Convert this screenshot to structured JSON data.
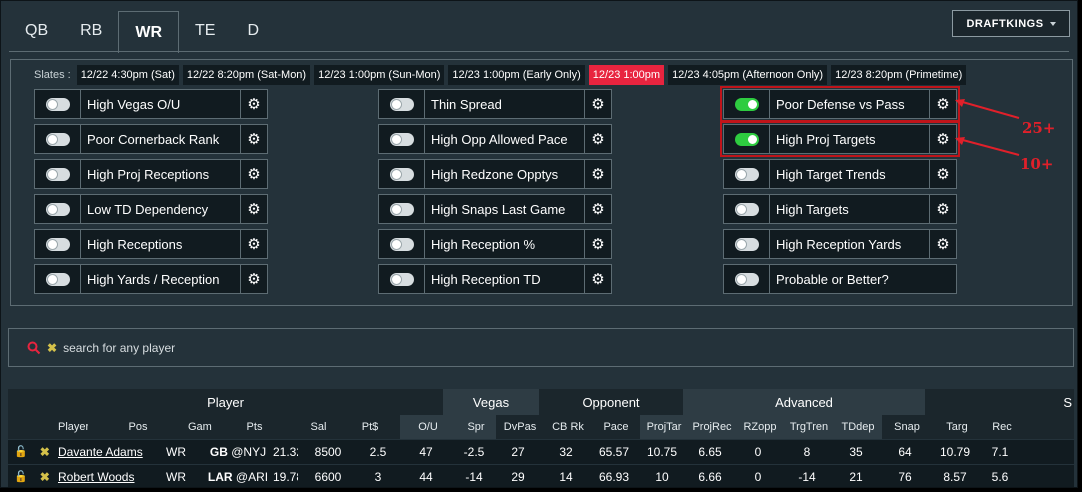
{
  "tabs": [
    "QB",
    "RB",
    "WR",
    "TE",
    "D"
  ],
  "active_tab": "WR",
  "site": "DRAFTKINGS",
  "slates_label": "Slates :",
  "slates": [
    "12/22 4:30pm (Sat)",
    "12/22 8:20pm (Sat-Mon)",
    "12/23 1:00pm (Sun-Mon)",
    "12/23 1:00pm (Early Only)",
    "12/23 1:00pm",
    "12/23 4:05pm (Afternoon Only)",
    "12/23 8:20pm (Primetime)"
  ],
  "active_slate": "12/23 1:00pm",
  "filters": {
    "col1": [
      "High Vegas O/U",
      "Poor Cornerback Rank",
      "High Proj Receptions",
      "Low TD Dependency",
      "High Receptions",
      "High Yards / Reception"
    ],
    "col2": [
      "Thin Spread",
      "High Opp Allowed Pace",
      "High Redzone Opptys",
      "High Snaps Last Game",
      "High Reception %",
      "High Reception TD"
    ],
    "col3": [
      "Poor Defense vs Pass",
      "High Proj Targets",
      "High Target Trends",
      "High Targets",
      "High Reception Yards",
      "Probable or Better?"
    ]
  },
  "annotations": [
    "25+",
    "10+"
  ],
  "colors": {
    "accent": "#e8243f",
    "toggle_on": "#2ecc40",
    "bg": "#24323a"
  },
  "search": {
    "placeholder": "search for any player"
  },
  "table": {
    "groups": [
      "Player",
      "Vegas",
      "Opponent",
      "Advanced"
    ],
    "group_last": "S",
    "headers": [
      "Player",
      "Pos",
      "Game",
      "Pts",
      "Sal",
      "Pt$",
      "O/U",
      "Spr",
      "DvPas",
      "CB Rk",
      "Pace",
      "ProjTar",
      "ProjRec",
      "RZopp",
      "TrgTren",
      "TDdep",
      "Snap",
      "Targ",
      "Rec"
    ],
    "rows": [
      {
        "player": "Davante Adams",
        "pos": "WR",
        "team": "GB",
        "opp": "@NYJ",
        "pts": "21.32",
        "sal": "8500",
        "ptd": "2.5",
        "ou": "47",
        "spr": "-2.5",
        "dvpas": "27",
        "cbrk": "32",
        "pace": "65.57",
        "projtar": "10.75",
        "projrec": "6.65",
        "rzopp": "0",
        "trgtren": "8",
        "tddep": "35",
        "snap": "64",
        "targ": "10.79",
        "rec": "7.1"
      },
      {
        "player": "Robert Woods",
        "pos": "WR",
        "team": "LAR",
        "opp": "@ARI",
        "pts": "19.78",
        "sal": "6600",
        "ptd": "3",
        "ou": "44",
        "spr": "-14",
        "dvpas": "29",
        "cbrk": "14",
        "pace": "66.93",
        "projtar": "10",
        "projrec": "6.66",
        "rzopp": "0",
        "trgtren": "-14",
        "tddep": "21",
        "snap": "76",
        "targ": "8.57",
        "rec": "5.6"
      }
    ]
  }
}
